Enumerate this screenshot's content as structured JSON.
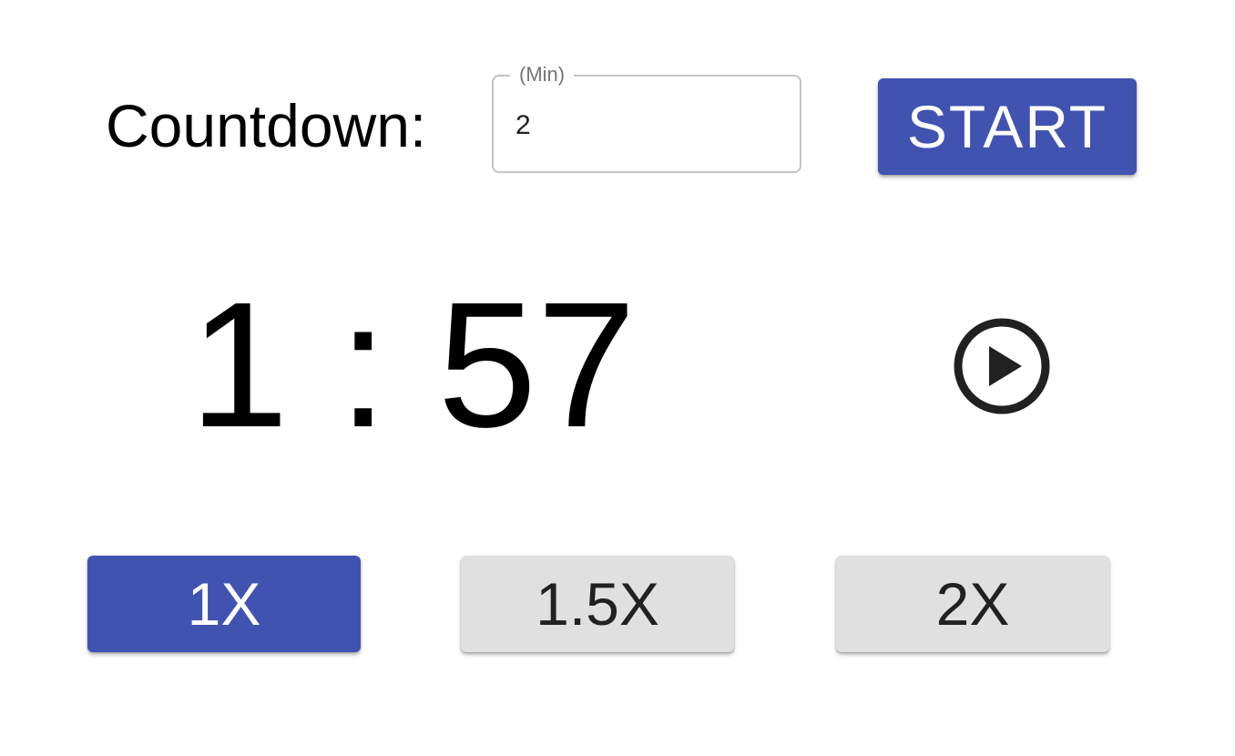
{
  "countdown": {
    "label": "Countdown:",
    "field_legend": "(Min)",
    "field_value": "2",
    "start_label": "START"
  },
  "timer": {
    "display": "1 : 57",
    "play_icon": "play-circle-outline-icon"
  },
  "speeds": [
    {
      "label": "1X",
      "selected": true
    },
    {
      "label": "1.5X",
      "selected": false
    },
    {
      "label": "2X",
      "selected": false
    }
  ],
  "colors": {
    "accent": "#4153b0",
    "inactive_button": "#e0e0e0"
  }
}
